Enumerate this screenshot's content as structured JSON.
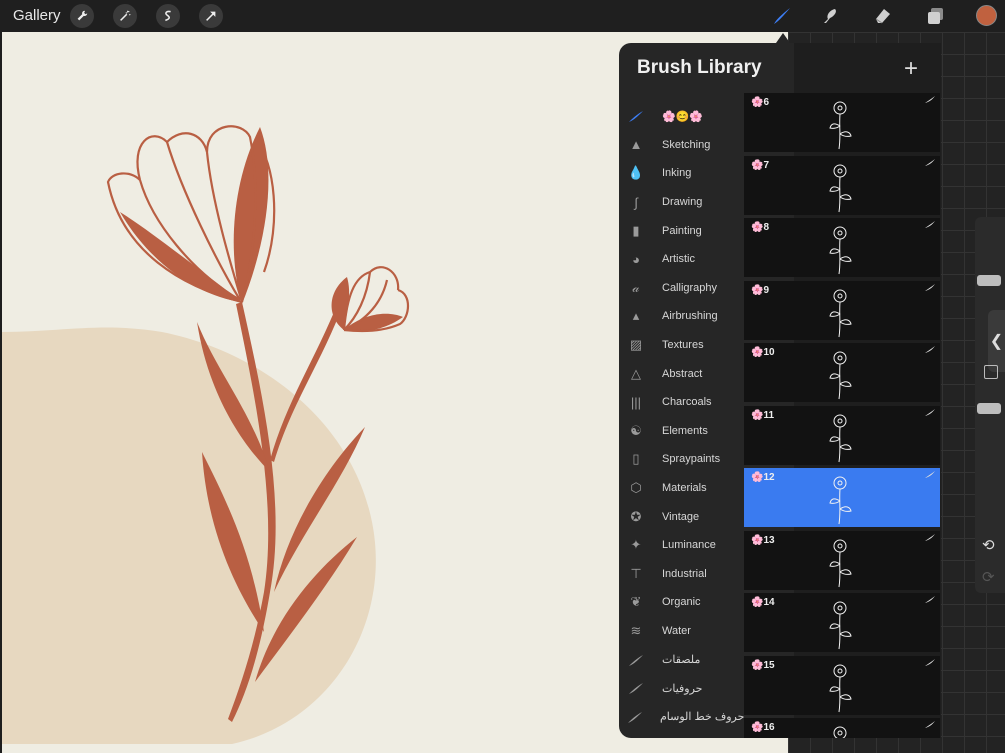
{
  "topbar": {
    "gallery_label": "Gallery",
    "left_tools": [
      {
        "name": "wrench-icon"
      },
      {
        "name": "magic-wand-icon"
      },
      {
        "name": "selection-icon"
      },
      {
        "name": "transform-arrow-icon"
      }
    ],
    "right_tools": [
      {
        "name": "brush-tool-icon",
        "active": true
      },
      {
        "name": "smudge-tool-icon"
      },
      {
        "name": "eraser-tool-icon"
      },
      {
        "name": "layers-icon"
      }
    ],
    "current_color": "#c0613f"
  },
  "brush_library": {
    "title": "Brush Library",
    "add_icon": "plus-icon",
    "categories": [
      {
        "label": "🌸😊🌸",
        "icon": "brush-stroke-icon",
        "active": true
      },
      {
        "label": "Sketching",
        "icon": "pencil-tip-icon"
      },
      {
        "label": "Inking",
        "icon": "ink-drop-icon"
      },
      {
        "label": "Drawing",
        "icon": "squiggle-icon"
      },
      {
        "label": "Painting",
        "icon": "paint-brush-icon"
      },
      {
        "label": "Artistic",
        "icon": "palette-icon"
      },
      {
        "label": "Calligraphy",
        "icon": "calligraphy-icon"
      },
      {
        "label": "Airbrushing",
        "icon": "airbrush-icon"
      },
      {
        "label": "Textures",
        "icon": "texture-icon"
      },
      {
        "label": "Abstract",
        "icon": "triangle-icon"
      },
      {
        "label": "Charcoals",
        "icon": "charcoal-icon"
      },
      {
        "label": "Elements",
        "icon": "yin-yang-icon"
      },
      {
        "label": "Spraypaints",
        "icon": "spray-can-icon"
      },
      {
        "label": "Materials",
        "icon": "cube-icon"
      },
      {
        "label": "Vintage",
        "icon": "star-badge-icon"
      },
      {
        "label": "Luminance",
        "icon": "sparkle-icon"
      },
      {
        "label": "Industrial",
        "icon": "anvil-icon"
      },
      {
        "label": "Organic",
        "icon": "leaf-icon"
      },
      {
        "label": "Water",
        "icon": "waves-icon"
      },
      {
        "label": "ملصقات",
        "icon": "brush-stroke-icon"
      },
      {
        "label": "حروفيات",
        "icon": "brush-stroke-icon"
      },
      {
        "label": "حروف خط الوسام",
        "icon": "brush-stroke-icon"
      }
    ],
    "brushes": [
      {
        "label": "🌸6"
      },
      {
        "label": "🌸7"
      },
      {
        "label": "🌸8"
      },
      {
        "label": "🌸9"
      },
      {
        "label": "🌸10"
      },
      {
        "label": "🌸11"
      },
      {
        "label": "🌸12",
        "selected": true
      },
      {
        "label": "🌸13"
      },
      {
        "label": "🌸14"
      },
      {
        "label": "🌸15"
      },
      {
        "label": "🌸16"
      }
    ]
  },
  "colors": {
    "flower": "#b95f43",
    "circle": "#e7d8c0",
    "paper": "#efede3",
    "selected_brush": "#3a7bf0"
  }
}
